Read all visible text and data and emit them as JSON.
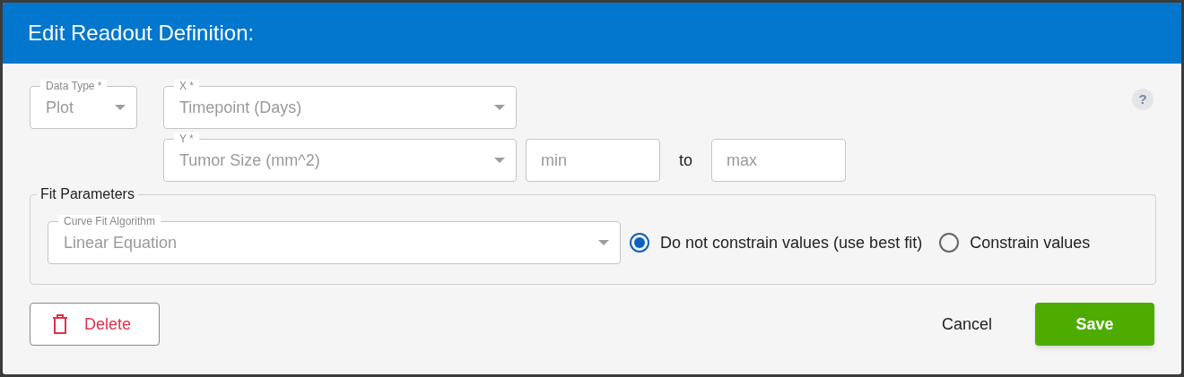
{
  "dialog": {
    "title": "Edit Readout Definition:"
  },
  "help": "?",
  "data_type": {
    "label": "Data Type *",
    "value": "Plot"
  },
  "x_axis": {
    "label": "X *",
    "value": "Timepoint (Days)"
  },
  "y_axis": {
    "label": "Y *",
    "value": "Tumor Size (mm^2)"
  },
  "range": {
    "min_placeholder": "min",
    "separator": "to",
    "max_placeholder": "max"
  },
  "fit_parameters": {
    "legend": "Fit Parameters",
    "algorithm": {
      "label": "Curve Fit Algorithm",
      "value": "Linear Equation"
    },
    "options": [
      {
        "label": "Do not constrain values (use best fit)",
        "selected": true
      },
      {
        "label": "Constrain values",
        "selected": false
      }
    ]
  },
  "buttons": {
    "delete": "Delete",
    "cancel": "Cancel",
    "save": "Save"
  }
}
